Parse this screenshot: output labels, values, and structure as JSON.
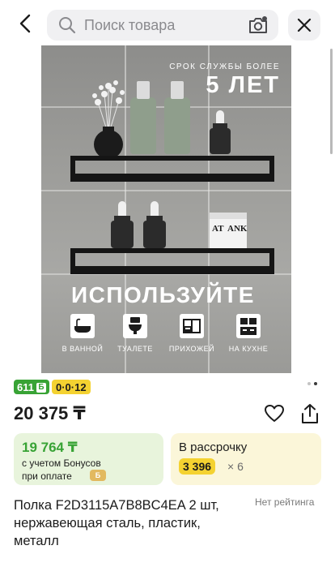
{
  "header": {
    "search_placeholder": "Поиск товара"
  },
  "image": {
    "promo_subtitle": "СРОК СЛУЖБЫ БОЛЕЕ",
    "promo_title": "5 ЛЕТ",
    "use_title": "ИСПОЛЬЗУЙТЕ",
    "features": [
      {
        "label": "В ВАННОЙ",
        "icon": "bathtub-icon"
      },
      {
        "label": "ТУАЛЕТЕ",
        "icon": "toilet-icon"
      },
      {
        "label": "ПРИХОЖЕЙ",
        "icon": "cabinet-icon"
      },
      {
        "label": "НА КУХНЕ",
        "icon": "kitchen-icon"
      }
    ],
    "label_left": "AT",
    "label_right": "ANK"
  },
  "gallery": {
    "dots_total": 2,
    "active_dot": 1
  },
  "tags": {
    "bonus_count": "611",
    "bonus_symbol": "Б",
    "installment": "0·0·12"
  },
  "price": {
    "value": "20 375 ₸"
  },
  "bonus_card": {
    "amount": "19 764 ₸",
    "line1": "с учетом Бонусов",
    "line2": "при оплате",
    "coin_symbol": "Б"
  },
  "installment_card": {
    "title": "В рассрочку",
    "monthly": "3 396",
    "multiplier": "× 6"
  },
  "product": {
    "title": "Полка F2D3115A7B8BC4EA 2 шт, нержавеющая сталь, пластик, металл",
    "rating": "Нет рейтинга"
  },
  "colors": {
    "green": "#38a335",
    "yellow": "#f4d231",
    "bonus_bg": "#e8f4dc",
    "installment_bg": "#fbf6d9"
  }
}
